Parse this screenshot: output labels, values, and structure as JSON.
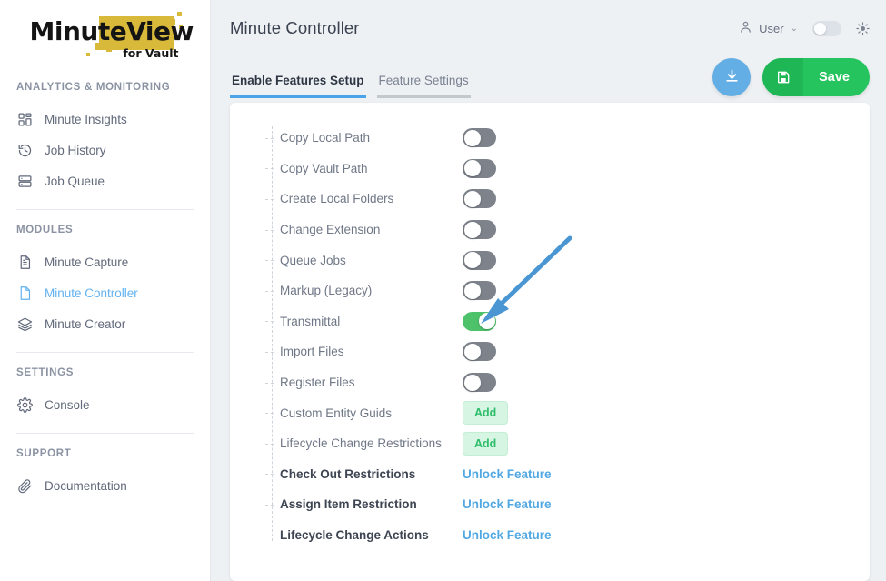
{
  "brand": {
    "name_part1": "Minute",
    "name_part2": "View",
    "tagline": "for Vault",
    "gold": "#d9b93a"
  },
  "sidebar": {
    "groups": [
      {
        "title": "ANALYTICS & MONITORING",
        "items": [
          {
            "label": "Minute Insights",
            "icon": "dashboard-grid-icon",
            "active": false
          },
          {
            "label": "Job History",
            "icon": "clock-history-icon",
            "active": false
          },
          {
            "label": "Job Queue",
            "icon": "server-stack-icon",
            "active": false
          }
        ]
      },
      {
        "title": "MODULES",
        "items": [
          {
            "label": "Minute Capture",
            "icon": "document-lines-icon",
            "active": false
          },
          {
            "label": "Minute Controller",
            "icon": "file-blank-icon",
            "active": true
          },
          {
            "label": "Minute Creator",
            "icon": "layers-icon",
            "active": false
          }
        ]
      },
      {
        "title": "SETTINGS",
        "items": [
          {
            "label": "Console",
            "icon": "gear-icon",
            "active": false
          }
        ]
      },
      {
        "title": "SUPPORT",
        "items": [
          {
            "label": "Documentation",
            "icon": "paperclip-icon",
            "active": false
          }
        ]
      }
    ]
  },
  "header": {
    "title": "Minute Controller",
    "user_label": "User",
    "user_caret": "⌄",
    "user_icon": "person-icon",
    "theme_toggle_state": "off",
    "sun_icon": "sun-icon"
  },
  "tabs": [
    {
      "label": "Enable Features Setup",
      "active": true
    },
    {
      "label": "Feature Settings",
      "active": false
    }
  ],
  "actions": {
    "download_icon": "download-icon",
    "save_icon": "floppy-save-icon",
    "save_label": "Save"
  },
  "features": [
    {
      "label": "Copy Local Path",
      "control": "toggle",
      "state": "off"
    },
    {
      "label": "Copy Vault Path",
      "control": "toggle",
      "state": "off"
    },
    {
      "label": "Create Local Folders",
      "control": "toggle",
      "state": "off"
    },
    {
      "label": "Change Extension",
      "control": "toggle",
      "state": "off"
    },
    {
      "label": "Queue Jobs",
      "control": "toggle",
      "state": "off"
    },
    {
      "label": "Markup (Legacy)",
      "control": "toggle",
      "state": "off"
    },
    {
      "label": "Transmittal",
      "control": "toggle",
      "state": "on"
    },
    {
      "label": "Import Files",
      "control": "toggle",
      "state": "off"
    },
    {
      "label": "Register Files",
      "control": "toggle",
      "state": "off"
    },
    {
      "label": "Custom Entity Guids",
      "control": "button",
      "button_label": "Add"
    },
    {
      "label": "Lifecycle Change Restrictions",
      "control": "button",
      "button_label": "Add"
    },
    {
      "label": "Check Out Restrictions",
      "control": "link",
      "link_label": "Unlock Feature",
      "locked": true
    },
    {
      "label": "Assign Item Restriction",
      "control": "link",
      "link_label": "Unlock Feature",
      "locked": true
    },
    {
      "label": "Lifecycle Change Actions",
      "control": "link",
      "link_label": "Unlock Feature",
      "locked": true
    }
  ],
  "annotation": {
    "type": "arrow",
    "color": "#4a96d2",
    "points_to": "Transmittal toggle"
  },
  "colors": {
    "accent_blue": "#4da3e8",
    "save_green": "#25c45e",
    "toggle_on_green": "#4ec26a",
    "link_blue": "#52a8e2",
    "add_green": "#2fbd6c"
  }
}
